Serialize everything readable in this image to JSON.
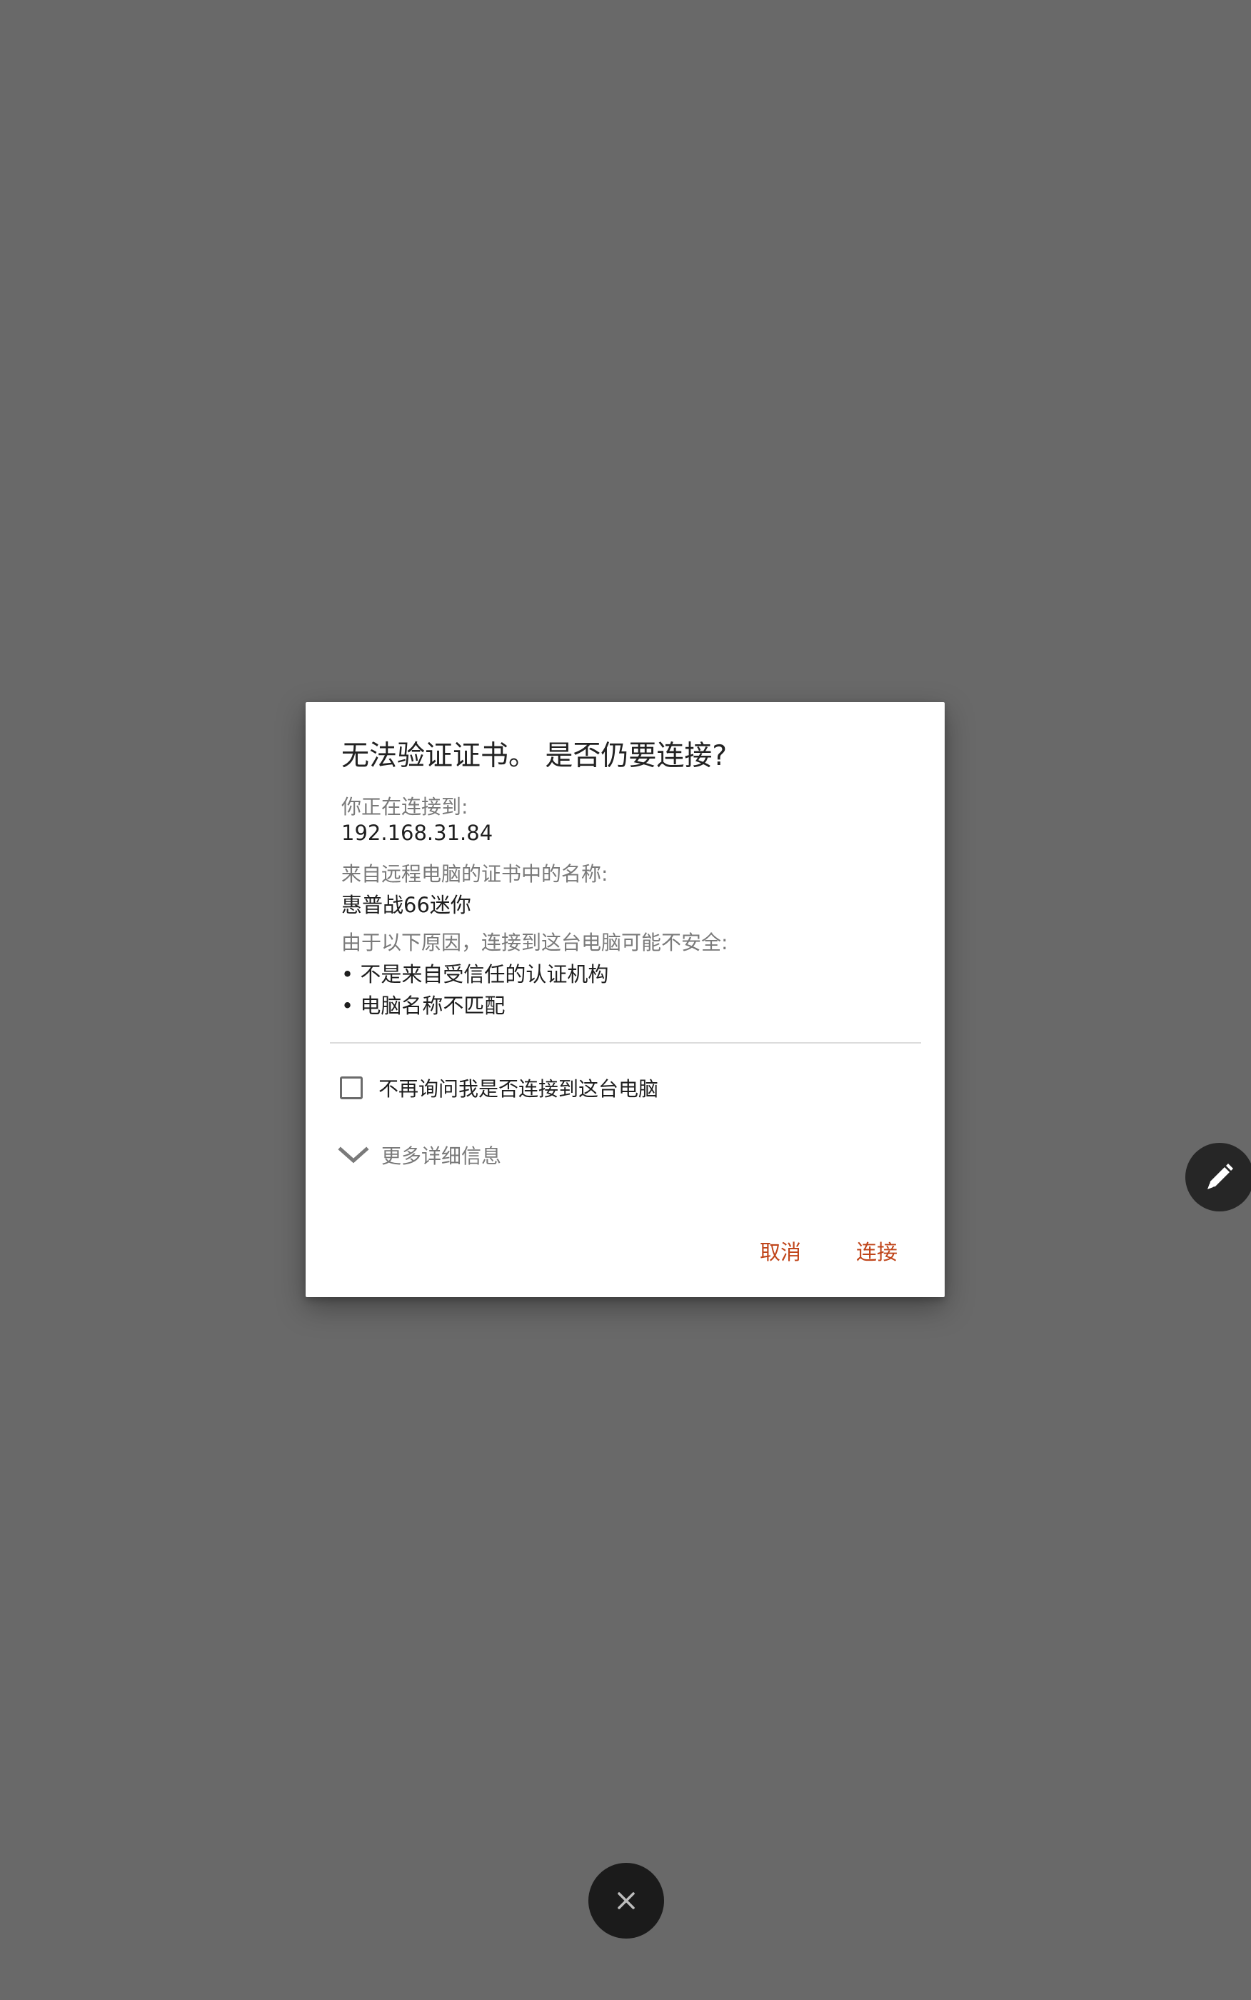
{
  "dialog": {
    "title": "无法验证证书。 是否仍要连接?",
    "connecting_to_label": "你正在连接到:",
    "host": "192.168.31.84",
    "cert_name_label": "来自远程电脑的证书中的名称:",
    "cert_name": "惠普战66迷你",
    "reasons_label": "由于以下原因，连接到这台电脑可能不安全:",
    "reasons": [
      "• 不是来自受信任的认证机构",
      "• 电脑名称不匹配"
    ],
    "dont_ask_checkbox": {
      "label": "不再询问我是否连接到这台电脑",
      "checked": false
    },
    "more_details_label": "更多详细信息",
    "cancel_label": "取消",
    "connect_label": "连接"
  },
  "floating_buttons": {
    "close_icon": "close-icon",
    "edit_icon": "pencil-icon"
  },
  "colors": {
    "backdrop": "#696969",
    "accent": "#c0451a",
    "fab": "#1b1b1b"
  }
}
